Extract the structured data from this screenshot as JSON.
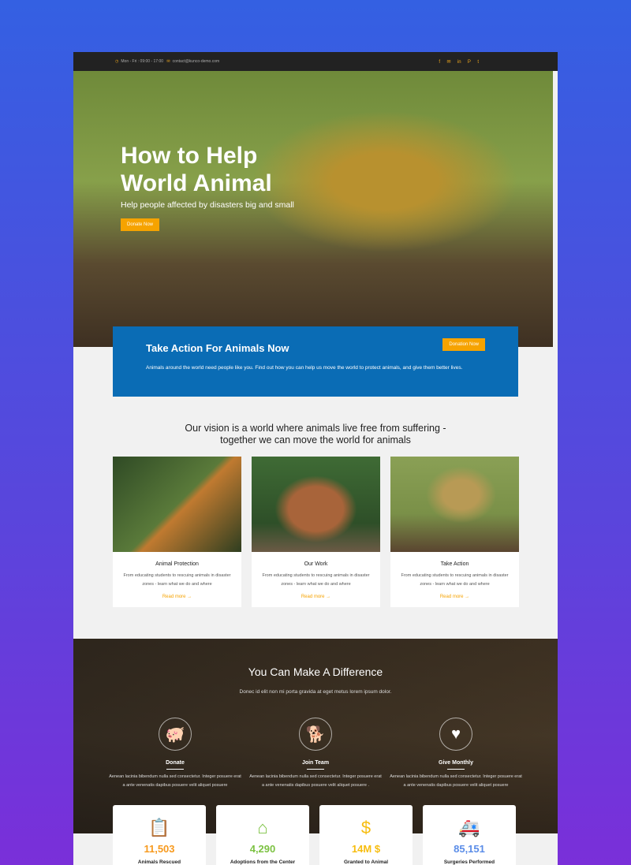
{
  "topbar": {
    "hours": "Mon - Fri : 09:00 - 17:00",
    "email": "contact@kunco-demo.com",
    "social": [
      "f",
      "✉",
      "in",
      "P",
      "t"
    ]
  },
  "hero": {
    "title": "How to Help World Animal",
    "subtitle": "Help people affected by disasters big and small",
    "button": "Donate Now"
  },
  "action": {
    "title": "Take Action For Animals Now",
    "text": "Animals around the world need people like you. Find out how you can help us move the world to protect animals, and give them better lives.",
    "button": "Donation Now"
  },
  "vision": {
    "line1": "Our vision is a world where animals live free from suffering -",
    "line2": "together we can move the world for animals"
  },
  "cards": [
    {
      "title": "Animal Protection",
      "text": "From educating students to rescuing animals in disaster zones - learn what we do and where",
      "link": "Read more →"
    },
    {
      "title": "Our Work",
      "text": "From educating students to rescuing animals in disaster zones - learn what we do and where",
      "link": "Read more →"
    },
    {
      "title": "Take Action",
      "text": "From educating students to rescuing animals in disaster zones - learn what we do and where",
      "link": "Read more →"
    }
  ],
  "difference": {
    "title": "You Can Make A Difference",
    "subtitle": "Donec id elit non mi porta gravida at eget metus lorem ipsum dolor.",
    "features": [
      {
        "title": "Donate",
        "text": "Aenean lacinia bibendum nulla sed consectetur. Integer posuere erat a ante venenatis dapibus posuere velit aliquet posuere",
        "icon": "piggy-bank-icon"
      },
      {
        "title": "Join Team",
        "text": "Aenean lacinia bibendum nulla sed consectetur. Integer posuere erat a ante venenatis dapibus posuere velit aliquet posuere .",
        "icon": "dog-icon"
      },
      {
        "title": "Give Monthly",
        "text": "Aenean lacinia bibendum nulla sed consectetur. Integer posuere erat a ante venenatis dapibus posuere velit aliquet posuere",
        "icon": "calendar-heart-icon"
      }
    ]
  },
  "stats": [
    {
      "value": "11,503",
      "label": "Animals Rescued",
      "color": "#f79a1e"
    },
    {
      "value": "4,290",
      "label": "Adoptions from the Center",
      "color": "#7cc242"
    },
    {
      "value": "14M $",
      "label": "Granted to Animal",
      "color": "#f7bd0f"
    },
    {
      "value": "85,151",
      "label": "Surgeries Performed",
      "color": "#5b8de8"
    }
  ]
}
